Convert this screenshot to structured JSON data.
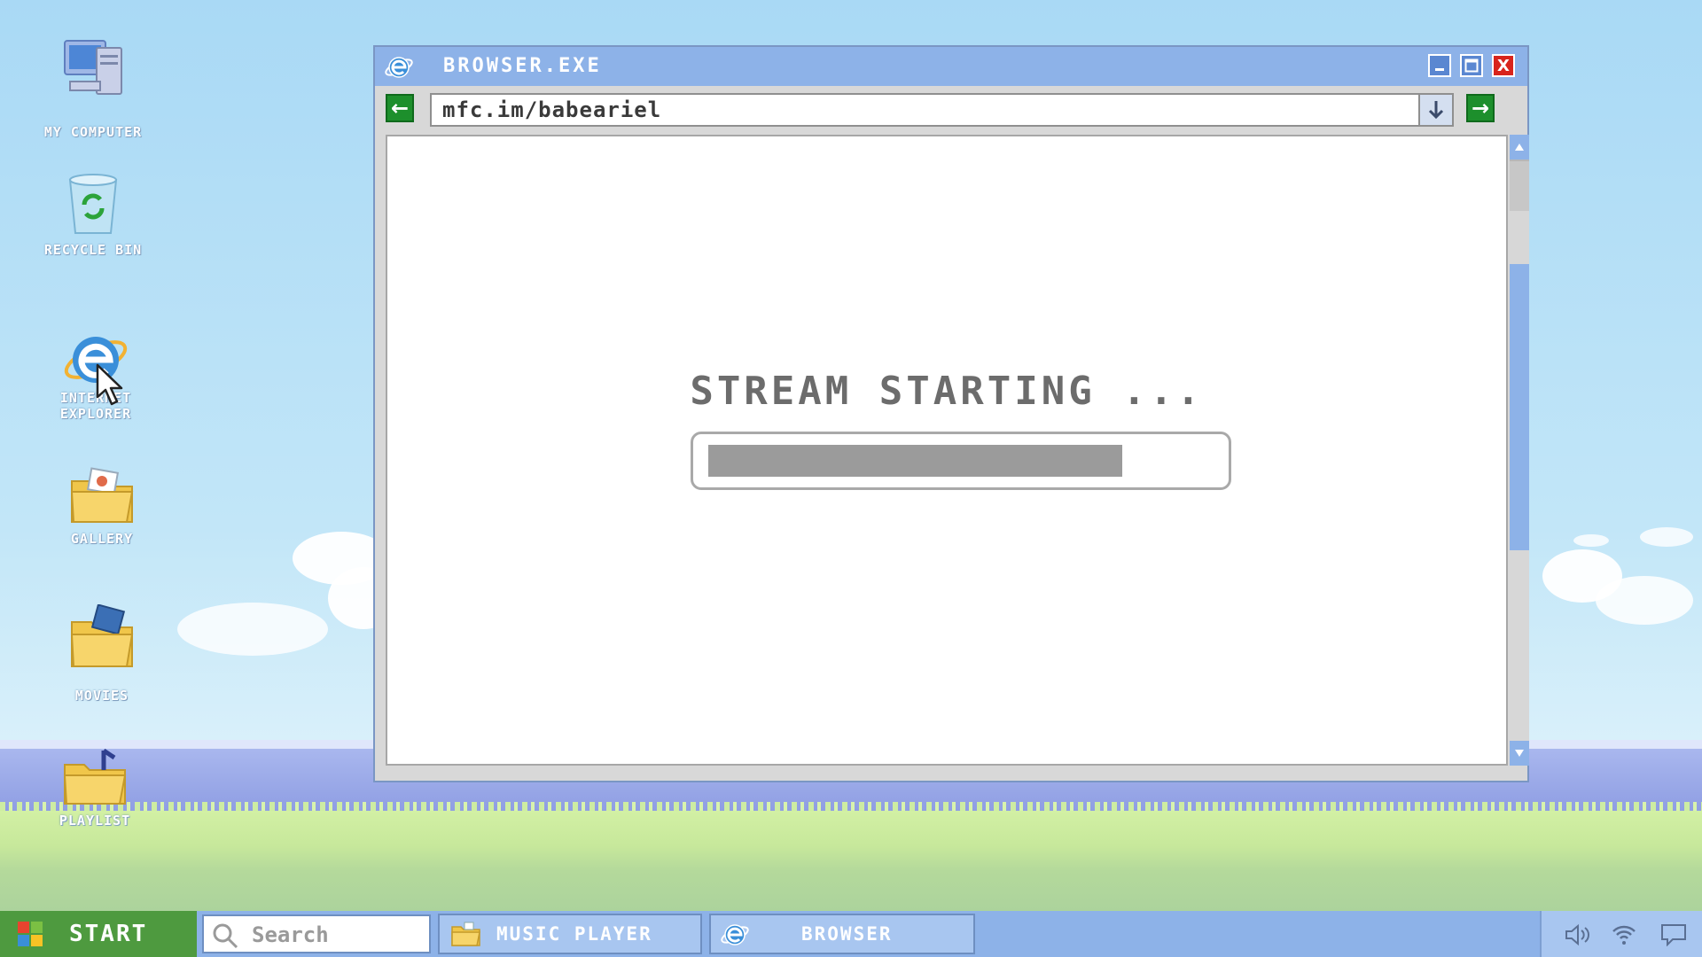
{
  "desktop": {
    "icons": [
      {
        "id": "my-computer",
        "label": "MY COMPUTER"
      },
      {
        "id": "recycle-bin",
        "label": "RECYCLE BIN"
      },
      {
        "id": "internet-explorer",
        "label_line1": "INTERNET",
        "label_line2": "EXPLORER"
      },
      {
        "id": "gallery",
        "label": "GALLERY"
      },
      {
        "id": "movies",
        "label": "MOVIES"
      },
      {
        "id": "playlist",
        "label": "PLAYLIST"
      }
    ]
  },
  "window": {
    "title": "BROWSER.EXE",
    "close_glyph": "X",
    "address": "mfc.im/babeariel",
    "back_glyph": "←",
    "forward_glyph": "→",
    "status_text": "STREAM STARTING ...",
    "progress_percent": 82
  },
  "taskbar": {
    "start_label": "START",
    "search_placeholder": "Search",
    "apps": [
      {
        "label": "MUSIC PLAYER",
        "icon": "folder-music-icon"
      },
      {
        "label": "BROWSER",
        "icon": "internet-explorer-icon"
      }
    ],
    "tray_icons": [
      "volume-icon",
      "wifi-icon",
      "notification-icon"
    ]
  },
  "colors": {
    "window_titlebar": "#8db2e8",
    "start_button": "#4e9a3f",
    "close_button": "#d8241c",
    "nav_arrows": "#1d8f2c",
    "progress_fill": "#9b9b9b"
  }
}
